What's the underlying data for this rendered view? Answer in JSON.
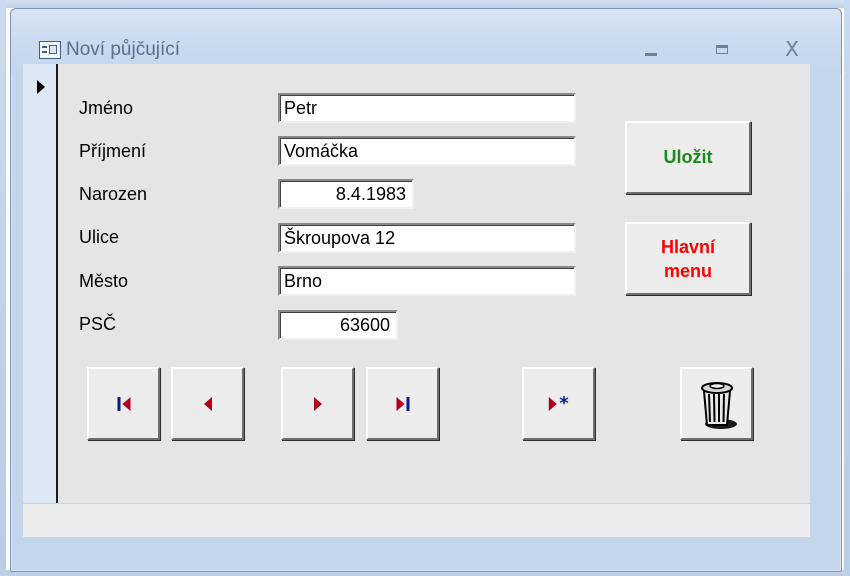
{
  "window": {
    "title": "Noví půjčující",
    "close_glyph": "X"
  },
  "form": {
    "fields": [
      {
        "label": "Jméno",
        "value": "Petr"
      },
      {
        "label": "Příjmení",
        "value": "Vomáčka"
      },
      {
        "label": "Narozen",
        "value": "8.4.1983"
      },
      {
        "label": "Ulice",
        "value": "Škroupova 12"
      },
      {
        "label": "Město",
        "value": "Brno"
      },
      {
        "label": "PSČ",
        "value": "63600"
      }
    ]
  },
  "buttons": {
    "save_label": "Uložit",
    "main_menu_line1": "Hlavní",
    "main_menu_line2": "menu",
    "save_color": "#1a8a1a",
    "main_menu_color": "#ff0000"
  },
  "navigation": {
    "first_icon": "first-record-icon",
    "prev_icon": "previous-record-icon",
    "next_icon": "next-record-icon",
    "last_icon": "last-record-icon",
    "new_icon": "new-record-icon",
    "delete_icon": "trash-can-icon",
    "arrow_color": "#b3001b",
    "bar_color": "#0b1a8a"
  }
}
